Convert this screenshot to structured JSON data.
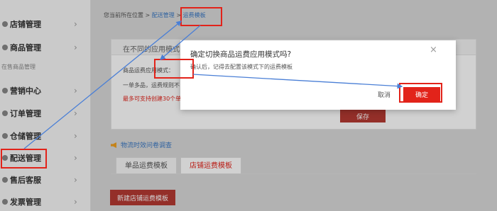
{
  "sidebar": {
    "items": [
      {
        "label": "店铺管理",
        "icon": "store-icon"
      },
      {
        "label": "商品管理",
        "icon": "goods-icon"
      },
      {
        "label": "营销中心",
        "icon": "marketing-icon"
      },
      {
        "label": "订单管理",
        "icon": "order-icon"
      },
      {
        "label": "仓储管理",
        "icon": "warehouse-icon"
      },
      {
        "label": "配送管理",
        "icon": "delivery-icon"
      },
      {
        "label": "售后客服",
        "icon": "service-icon"
      },
      {
        "label": "发票管理",
        "icon": "invoice-icon"
      }
    ],
    "sub_label": "在售商品管理",
    "chevron": "›"
  },
  "breadcrumb": {
    "prefix": "您当前所在位置 > ",
    "item1": "配送管理",
    "sep": " > ",
    "item2": "运费模板"
  },
  "panel": {
    "title": "在不同的应用模式",
    "line1": "商品运费应用模式：",
    "line2": "一单多品，运费规则不",
    "line3": "最多可支持创建30个单",
    "save_label": "保存"
  },
  "survey_link": "物流时效问卷调查",
  "tabs": [
    {
      "label": "单品运费模板"
    },
    {
      "label": "店铺运费模板"
    }
  ],
  "new_button": "新建店铺运费模板",
  "modal": {
    "title": "确定切换商品运费应用模式吗?",
    "description": "确认后，记得去配置该模式下的运费模板",
    "cancel_label": "取消",
    "confirm_label": "确定",
    "close_icon": "close-icon"
  },
  "colors": {
    "annotation_red": "#e2231a",
    "annotation_blue": "#4a7fd6",
    "confirm_red": "#e2231a"
  }
}
